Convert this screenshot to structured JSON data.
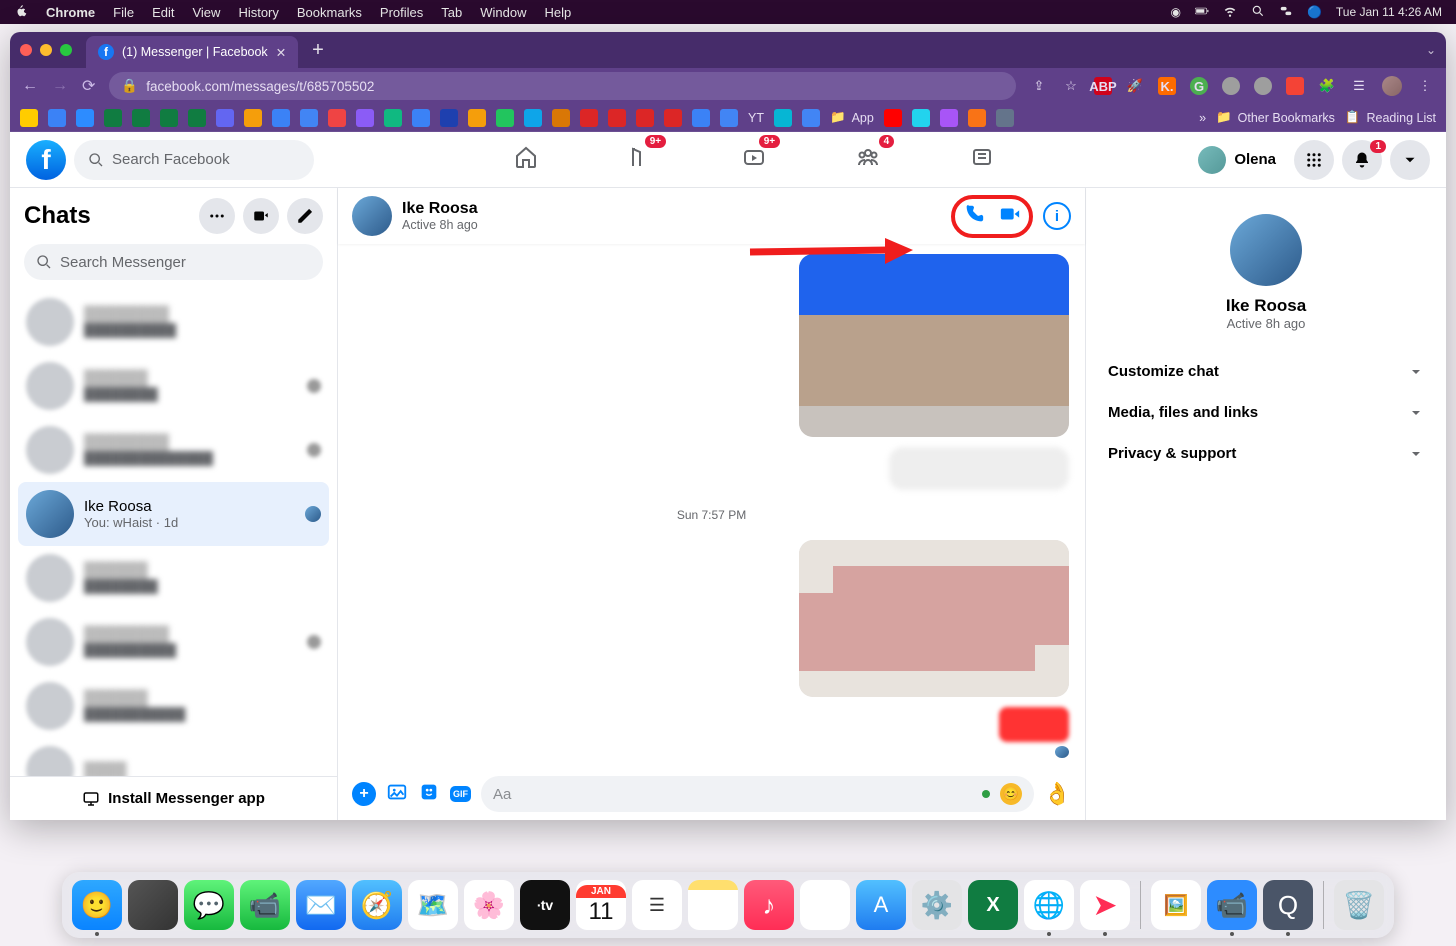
{
  "menubar": {
    "app": "Chrome",
    "items": [
      "File",
      "Edit",
      "View",
      "History",
      "Bookmarks",
      "Profiles",
      "Tab",
      "Window",
      "Help"
    ],
    "clock": "Tue Jan 11  4:26 AM"
  },
  "browser": {
    "tab_title": "(1) Messenger | Facebook",
    "url": "facebook.com/messages/t/685705502",
    "other_bookmarks": "Other Bookmarks",
    "reading_list": "Reading List",
    "bookmark_app": "App",
    "bookmark_yt": "YT"
  },
  "fb": {
    "search_placeholder": "Search Facebook",
    "nav_badges": {
      "pages": "9+",
      "watch": "9+",
      "groups": "4"
    },
    "profile_name": "Olena",
    "notif_badge": "1"
  },
  "chats": {
    "title": "Chats",
    "search_placeholder": "Search Messenger",
    "install": "Install Messenger app",
    "active": {
      "name": "Ike Roosa",
      "preview": "You: wHaist · 1d"
    }
  },
  "conv": {
    "name": "Ike Roosa",
    "status": "Active 8h ago",
    "timestamp": "Sun 7:57 PM",
    "composer_placeholder": "Aa"
  },
  "info": {
    "name": "Ike Roosa",
    "status": "Active 8h ago",
    "sections": [
      "Customize chat",
      "Media, files and links",
      "Privacy & support"
    ]
  },
  "dock": {
    "cal_month": "JAN",
    "cal_day": "11"
  }
}
